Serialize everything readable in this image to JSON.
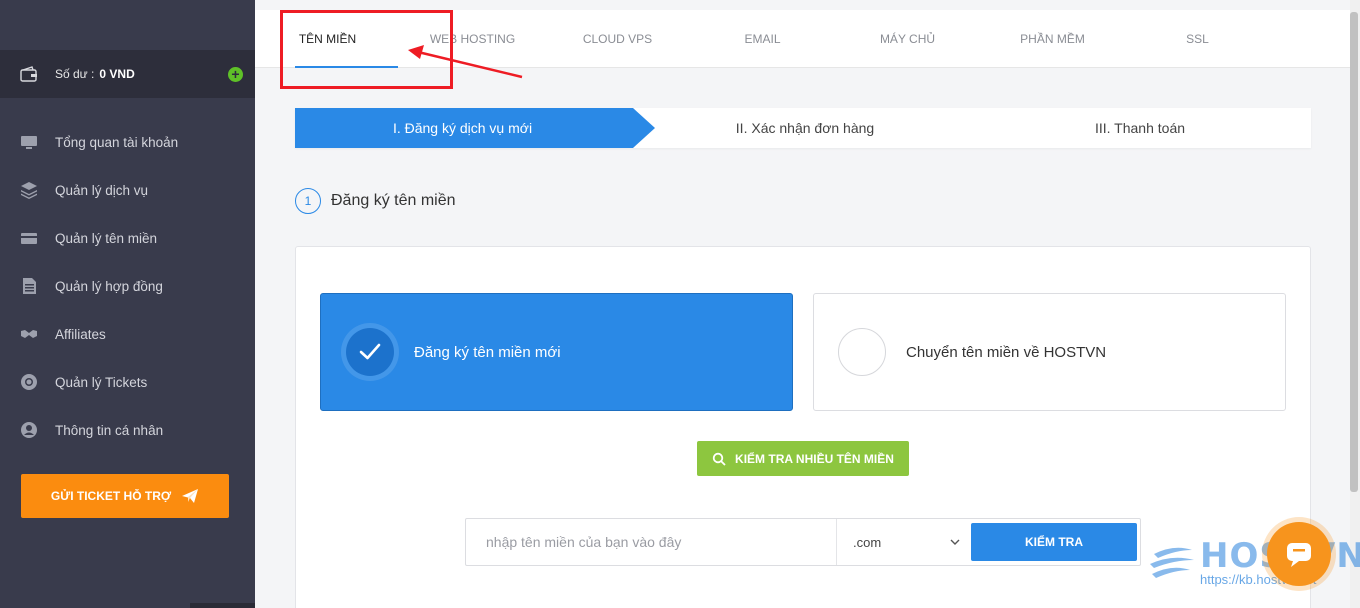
{
  "sidebar": {
    "balance": {
      "label": "Số dư :",
      "value": "0 VND"
    },
    "items": [
      {
        "label": "Tổng quan tài khoản",
        "icon": "monitor-icon"
      },
      {
        "label": "Quản lý dịch vụ",
        "icon": "layers-icon"
      },
      {
        "label": "Quản lý tên miền",
        "icon": "card-icon"
      },
      {
        "label": "Quản lý hợp đồng",
        "icon": "document-icon"
      },
      {
        "label": "Affiliates",
        "icon": "handshake-icon"
      },
      {
        "label": "Quản lý Tickets",
        "icon": "lifebuoy-icon"
      },
      {
        "label": "Thông tin cá nhân",
        "icon": "user-icon"
      }
    ],
    "ticket_button": "GỬI TICKET HỖ TRỢ"
  },
  "tabs": [
    "TÊN MIỀN",
    "WEB HOSTING",
    "CLOUD VPS",
    "EMAIL",
    "MÁY CHỦ",
    "PHẦN MỀM",
    "SSL"
  ],
  "steps": [
    "I. Đăng ký dịch vụ mới",
    "II. Xác nhận đơn hàng",
    "III. Thanh toán"
  ],
  "section": {
    "number": "1",
    "title": "Đăng ký tên miền"
  },
  "options": {
    "new": "Đăng ký tên miền mới",
    "transfer": "Chuyển tên miền về HOSTVN"
  },
  "multi_check_button": "KIỂM TRA NHIỀU TÊN MIỀN",
  "search": {
    "placeholder": "nhập tên miền của bạn vào đây",
    "tld": ".com",
    "button": "KIỂM TRA"
  },
  "watermark": {
    "brand": "HOSTVN",
    "url": "https://kb.hostvn.net"
  },
  "colors": {
    "primary": "#2a89e6",
    "green": "#8dc63f",
    "orange": "#fb8c0f",
    "sidebar": "#393b4c"
  }
}
